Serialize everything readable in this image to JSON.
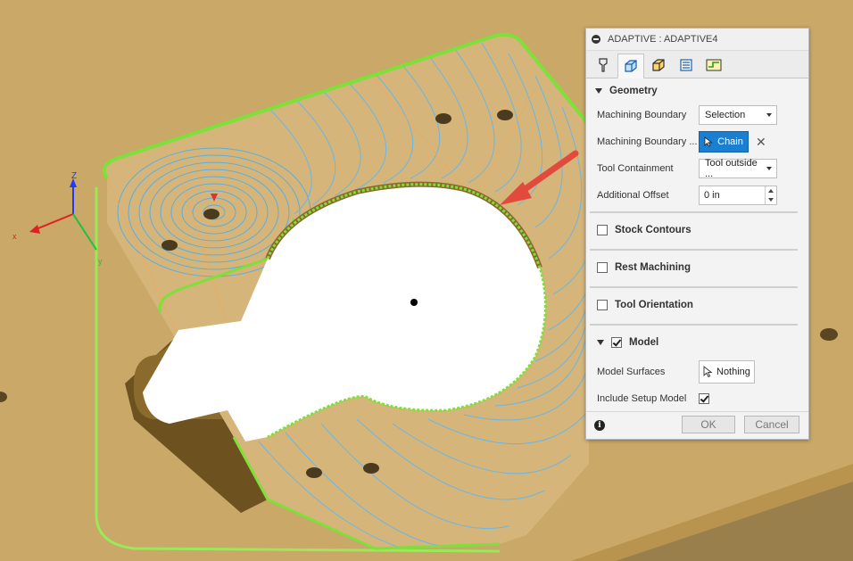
{
  "dialog": {
    "title": "ADAPTIVE : ADAPTIVE4",
    "tabs": [
      "tool-tab",
      "geometry-tab",
      "heights-tab",
      "passes-tab",
      "linking-tab"
    ],
    "geometry": {
      "header": "Geometry",
      "machining_boundary_label": "Machining Boundary",
      "machining_boundary_value": "Selection",
      "selection_label": "Machining Boundary ...",
      "chain_label": "Chain",
      "clear_symbol": "✕",
      "tool_containment_label": "Tool Containment",
      "tool_containment_value": "Tool outside ...",
      "additional_offset_label": "Additional Offset",
      "additional_offset_value": "0 in"
    },
    "stock_contours": {
      "label": "Stock Contours",
      "checked": false
    },
    "rest_machining": {
      "label": "Rest Machining",
      "checked": false
    },
    "tool_orientation": {
      "label": "Tool Orientation",
      "checked": false
    },
    "model": {
      "label": "Model",
      "checked": true,
      "model_surfaces_label": "Model Surfaces",
      "model_surfaces_value": "Nothing",
      "include_setup_label": "Include Setup Model",
      "include_setup_checked": true
    },
    "footer": {
      "ok_label": "OK",
      "cancel_label": "Cancel",
      "info_symbol": "i"
    }
  },
  "axes": {
    "z_label": "Z",
    "x_label": "x",
    "y_label": "y"
  },
  "colors": {
    "background": "#c8a664",
    "toolpath": "#5aaee0",
    "boundary": "#7ee03a",
    "highlight": "#e24a3d",
    "chain_button": "#1a7fd0"
  }
}
